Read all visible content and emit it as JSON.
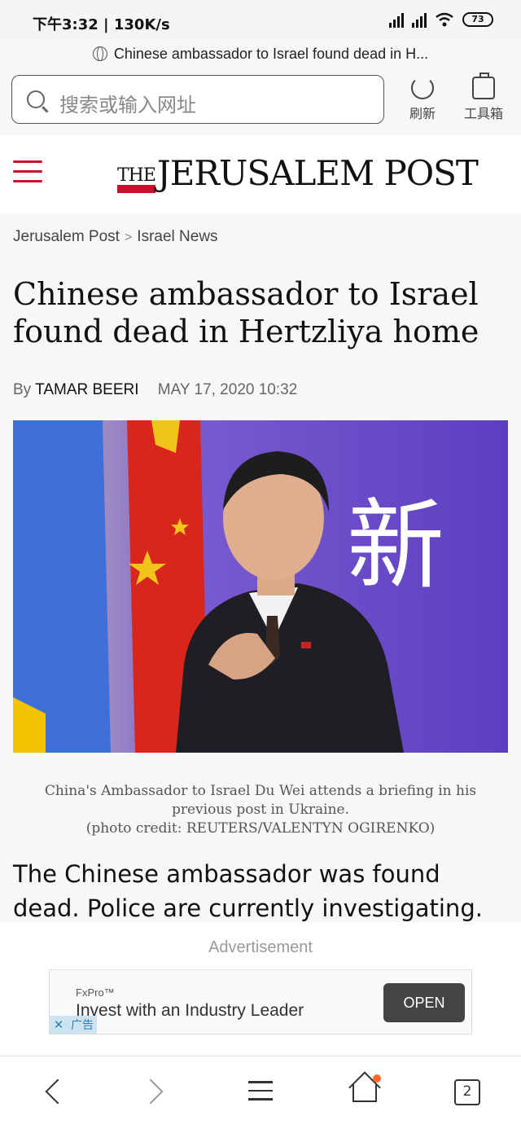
{
  "status_bar": {
    "time_speed": "下午3:32 | 130K/s",
    "battery": "73"
  },
  "browser": {
    "page_title": "Chinese ambassador to Israel found dead in H...",
    "search_placeholder": "搜索或输入网址",
    "refresh_label": "刷新",
    "toolbox_label": "工具箱",
    "tab_count": "2"
  },
  "site": {
    "logo_the": "THE",
    "logo_name": "JERUSALEM POST",
    "brand_color": "#c8102e"
  },
  "article": {
    "breadcrumb": [
      "Jerusalem Post",
      "Israel News"
    ],
    "breadcrumb_sep": ">",
    "headline": "Chinese ambassador to Israel found dead in Hertzliya home",
    "by_prefix": "By",
    "author": "TAMAR BEERI",
    "date": "MAY 17, 2020 10:32",
    "photo_text": "新",
    "caption_line1": "China's Ambassador to Israel Du Wei attends a briefing in his previous post in Ukraine.",
    "caption_line2": "(photo credit: REUTERS/VALENTYN OGIRENKO)",
    "lede": "The Chinese ambassador was found dead. Police are currently investigating."
  },
  "ad": {
    "label": "Advertisement",
    "brand": "FxPro™",
    "text": "Invest with an Industry Leader",
    "cta": "OPEN",
    "close": "✕",
    "tag": "广告"
  }
}
